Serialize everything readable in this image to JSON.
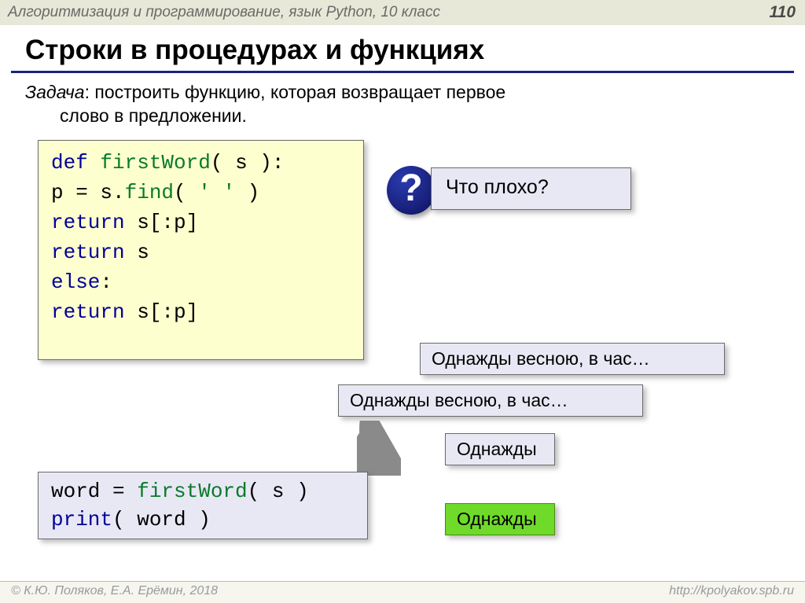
{
  "header": {
    "breadcrumb": "Алгоритмизация и программирование, язык Python, 10 класс",
    "page_number": "110"
  },
  "title": "Строки в процедурах и функциях",
  "task": {
    "label": "Задача",
    "text_1": ": построить функцию, которая возвращает первое",
    "text_2": "слово в предложении."
  },
  "code1": {
    "l1a": "def ",
    "l1b": "firstWord",
    "l1c": "( s ):",
    "l2a": "  p = s.",
    "l2b": "find",
    "l2c": "( ",
    "l2d": "' '",
    "l2e": " )",
    "l3a": "  ",
    "l3b": "return",
    "l3c": " s[:p]",
    "l4a": "    ",
    "l4b": "return",
    "l4c": " s",
    "l5a": "  ",
    "l5b": "else",
    "l5c": ":",
    "l6a": "    ",
    "l6b": "return",
    "l6c": " s[:p]"
  },
  "question": {
    "mark": "?",
    "text": "Что плохо?"
  },
  "boxes": {
    "b1": "Однажды весною, в час…",
    "b2": "Однажды весною, в час…",
    "b3": "Однажды",
    "b4": "Однажды"
  },
  "code2": {
    "l1a": "word = ",
    "l1b": "firstWord",
    "l1c": "( s )",
    "l2a": "print",
    "l2b": "( word )"
  },
  "footer": {
    "left": "© К.Ю. Поляков, Е.А. Ерёмин, 2018",
    "right": "http://kpolyakov.spb.ru"
  }
}
